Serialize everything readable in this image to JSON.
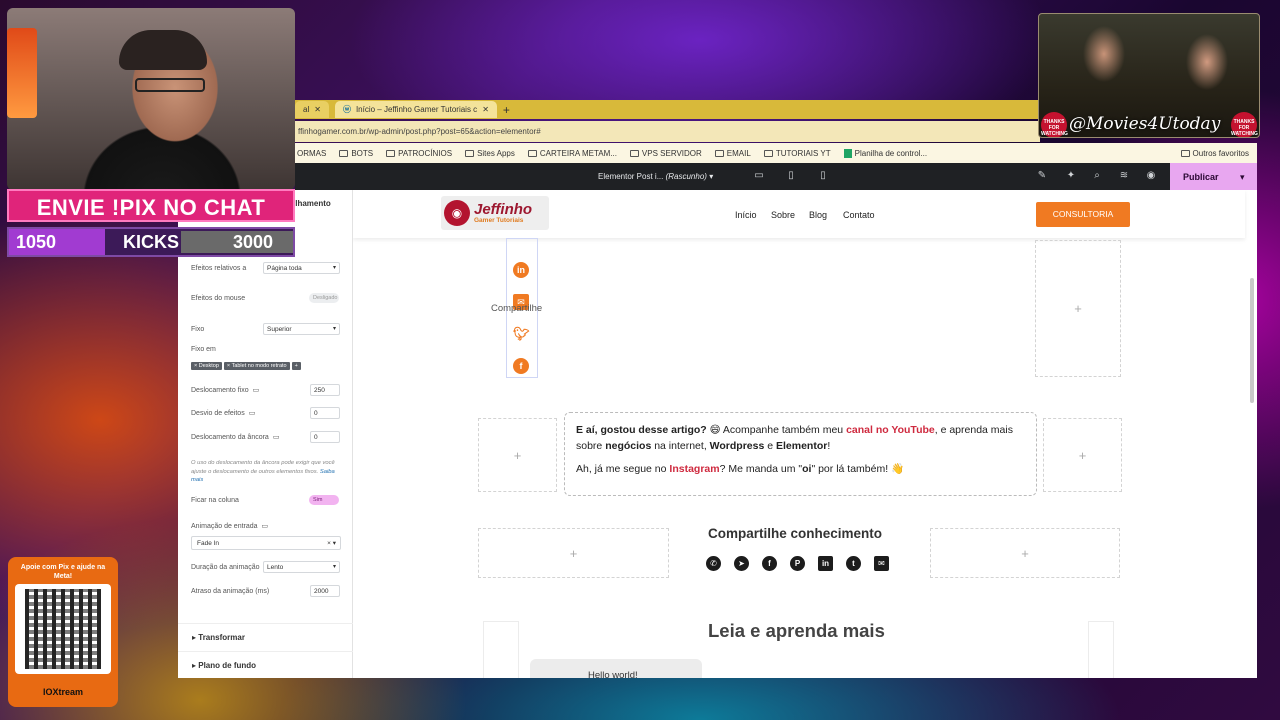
{
  "browser": {
    "tabs": [
      {
        "label": "al"
      },
      {
        "label": "Início – Jeffinho Gamer Tutoriais c"
      }
    ],
    "new_tab": "+",
    "url": "ffinhogamer.com.br/wp-admin/post.php?post=65&action=elementor#",
    "bookmarks": [
      "ORMAS",
      "BOTS",
      "PATROCÍNIOS",
      "Sites Apps",
      "CARTEIRA METAM...",
      "VPS SERVIDOR",
      "EMAIL",
      "TUTORIAIS YT",
      "Planilha de control..."
    ],
    "other_bookmarks": "Outros favoritos"
  },
  "elementor": {
    "doc_title": "Elementor Post i...",
    "doc_status": "(Rascunho)",
    "publish": "Publicar",
    "panel_tab": "ilhamento",
    "panel": {
      "relative_effects_label": "Efeitos relativos a",
      "relative_effects_value": "Página toda",
      "mouse_effects_label": "Efeitos do mouse",
      "mouse_effects_toggle": "Desligado",
      "sticky_label": "Fixo",
      "sticky_value": "Superior",
      "sticky_on_label": "Fixo em",
      "chip_desktop": "× Desktop",
      "chip_tablet": "× Tablet no modo retrato",
      "chip_add": "+",
      "sticky_offset_label": "Deslocamento fixo",
      "sticky_offset_value": "250",
      "effects_offset_label": "Desvio de efeitos",
      "effects_offset_value": "0",
      "anchor_offset_label": "Deslocamento da âncora",
      "anchor_offset_value": "0",
      "note": "O uso do deslocamento da âncora pode exigir que você ajuste o deslocamento de outros elementos fixos.",
      "note_link": "Saiba mais",
      "stay_in_column_label": "Ficar na coluna",
      "stay_in_column_toggle": "Sim",
      "entrance_anim_label": "Animação de entrada",
      "entrance_anim_value": "Fade In",
      "anim_duration_label": "Duração da animação",
      "anim_duration_value": "Lento",
      "anim_delay_label": "Atraso da animação (ms)",
      "anim_delay_value": "2000",
      "section_transform": "Transformar",
      "section_background": "Plano de fundo"
    }
  },
  "site": {
    "logo_line1": "Jeffinho",
    "logo_line2": "Gamer Tutoriais",
    "nav": [
      "Início",
      "Sobre",
      "Blog",
      "Contato"
    ],
    "cta": "CONSULTORIA",
    "share_side_label": "Compartilhe",
    "callout": {
      "l1a": "E aí, gostou desse artigo?",
      "l1b": " 😄 Acompanhe também meu ",
      "l1c": "canal no YouTube",
      "l1d": ", e aprenda mais",
      "l2a": "sobre ",
      "l2b": "negócios",
      "l2c": " na internet, ",
      "l2d": "Wordpress",
      "l2e": " e ",
      "l2f": "Elementor",
      "l2g": "!",
      "l3a": "Ah, já me segue no ",
      "l3b": "Instagram",
      "l3c": "? Me manda um \"",
      "l3d": "oi",
      "l3e": "\" por lá também! 👋"
    },
    "share_heading": "Compartilhe conhecimento",
    "read_more_heading": "Leia e aprenda mais",
    "post_card": "Hello world!"
  },
  "stream": {
    "pix_banner": "ENVIE !PIX NO CHAT",
    "goal_current": "1050",
    "goal_label": "KICKS",
    "goal_target": "3000",
    "movies_tag": "@Movies4Utoday",
    "thanks_badge": "THANKS FOR WATCHING",
    "pix_card_text": "Apoie com Pix e ajude na Meta!",
    "pix_card_brand": "IOXtream"
  }
}
